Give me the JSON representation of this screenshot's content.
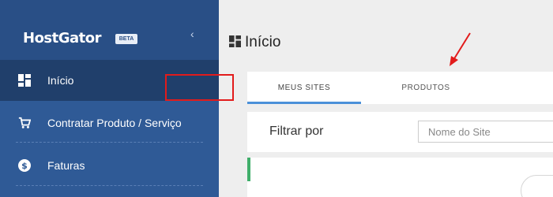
{
  "brand": {
    "name": "HostGator",
    "badge": "BETA",
    "collapse_icon": "chevron-left-icon"
  },
  "sidebar": {
    "items": [
      {
        "label": "Início",
        "icon": "dashboard-icon",
        "active": true
      },
      {
        "label": "Contratar Produto / Serviço",
        "icon": "cart-icon",
        "active": false
      },
      {
        "label": "Faturas",
        "icon": "dollar-circle-icon",
        "active": false
      }
    ]
  },
  "main": {
    "title": "Início",
    "tabs": [
      {
        "label": "MEUS SITES",
        "selected": true
      },
      {
        "label": "PRODUTOS",
        "selected": false
      }
    ],
    "filter": {
      "label": "Filtrar por",
      "placeholder": "Nome do Site"
    }
  },
  "colors": {
    "sidebar": "#2f5a96",
    "sidebar_active": "#203f6b",
    "tab_indicator": "#4a90d9",
    "highlight": "#e21b1b",
    "status_green": "#3fae6a"
  }
}
